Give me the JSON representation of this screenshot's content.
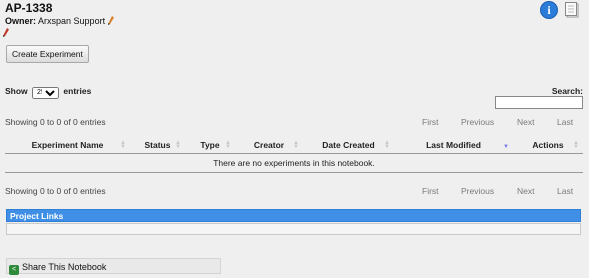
{
  "notebook": {
    "title": "AP-1338",
    "owner_label": "Owner:",
    "owner_name": "Arxspan Support"
  },
  "toolbar": {
    "create_label": "Create Experiment"
  },
  "table_controls": {
    "show_label": "Show",
    "page_size": "25",
    "entries_label": "entries",
    "search_label": "Search:",
    "search_value": ""
  },
  "info_top": "Showing 0 to 0 of 0 entries",
  "info_bottom": "Showing 0 to 0 of 0 entries",
  "pager": {
    "first": "First",
    "previous": "Previous",
    "next": "Next",
    "last": "Last"
  },
  "columns": [
    "Experiment Name",
    "Status",
    "Type",
    "Creator",
    "Date Created",
    "Last Modified",
    "Actions"
  ],
  "empty_message": "There are no experiments in this notebook.",
  "project_links": {
    "title": "Project Links"
  },
  "share": {
    "label": "Share This Notebook"
  },
  "icons": {
    "info": "info-icon",
    "document": "document-icon",
    "edit": "pencil-icon",
    "share": "share-icon"
  },
  "colors": {
    "accent": "#3f8fe6",
    "info_icon": "#2b7bd8",
    "share_icon": "#2e8b3a"
  }
}
